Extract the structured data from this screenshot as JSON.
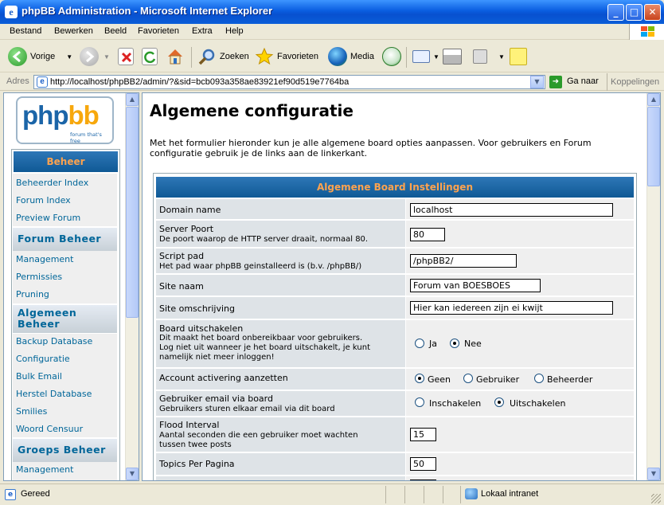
{
  "window": {
    "title": "phpBB Administration - Microsoft Internet Explorer"
  },
  "menu": [
    "Bestand",
    "Bewerken",
    "Beeld",
    "Favorieten",
    "Extra",
    "Help"
  ],
  "toolbar": {
    "back": "Vorige",
    "search": "Zoeken",
    "favorites": "Favorieten",
    "media": "Media"
  },
  "address": {
    "label": "Adres",
    "url": "http://localhost/phpBB2/admin/?&sid=bcb093a358ae83921ef90d519e7764ba",
    "go": "Ga naar",
    "links": "Koppelingen"
  },
  "logo": {
    "text_a": "php",
    "text_b": "bb",
    "tagline": "forum that's free"
  },
  "nav": {
    "beheer": "Beheer",
    "beheer_items": [
      "Beheerder Index",
      "Forum Index",
      "Preview Forum"
    ],
    "forum_beheer": "Forum Beheer",
    "forum_items": [
      "Management",
      "Permissies",
      "Pruning"
    ],
    "algemeen_beheer_1": "Algemeen",
    "algemeen_beheer_2": "Beheer",
    "algemeen_items": [
      "Backup Database",
      "Configuratie",
      "Bulk Email",
      "Herstel Database",
      "Smilies",
      "Woord Censuur"
    ],
    "groeps_beheer": "Groeps Beheer",
    "groeps_items": [
      "Management"
    ]
  },
  "page": {
    "title": "Algemene configuratie",
    "intro_1": "Met het formulier hieronder kun je alle algemene board opties aanpassen. Voor gebruikers en Forum",
    "intro_2": "configuratie gebruik je de links aan de linkerkant.",
    "table_header": "Algemene Board Instellingen"
  },
  "form": {
    "domain_name": {
      "label": "Domain name",
      "value": "localhost"
    },
    "server_port": {
      "label": "Server Poort",
      "desc": "De poort waarop de HTTP server draait, normaal 80.",
      "value": "80"
    },
    "script_path": {
      "label": "Script pad",
      "desc": "Het pad waar phpBB geinstalleerd is (b.v. /phpBB/)",
      "value": "/phpBB2/"
    },
    "site_name": {
      "label": "Site naam",
      "value": "Forum van BOESBOES"
    },
    "site_desc": {
      "label": "Site omschrijving",
      "value": "Hier kan iedereen zijn ei kwijt"
    },
    "disable_board": {
      "label": "Board uitschakelen",
      "desc_1": "Dit maakt het board onbereikbaar voor gebruikers.",
      "desc_2": "Log niet uit wanneer je het board uitschakelt, je kunt",
      "desc_3": "namelijk niet meer inloggen!",
      "opt_yes": "Ja",
      "opt_no": "Nee",
      "selected": "Nee"
    },
    "account_activation": {
      "label": "Account activering aanzetten",
      "opt_none": "Geen",
      "opt_user": "Gebruiker",
      "opt_admin": "Beheerder",
      "selected": "Geen"
    },
    "user_email": {
      "label": "Gebruiker email via board",
      "desc": "Gebruikers sturen elkaar email via dit board",
      "opt_on": "Inschakelen",
      "opt_off": "Uitschakelen",
      "selected": "Uitschakelen"
    },
    "flood_interval": {
      "label": "Flood Interval",
      "desc_1": "Aantal seconden die een gebruiker moet wachten",
      "desc_2": "tussen twee posts",
      "value": "15"
    },
    "topics_per_page": {
      "label": "Topics Per Pagina",
      "value": "50"
    }
  },
  "status": {
    "left": "Gereed",
    "zone": "Lokaal intranet"
  },
  "colors": {
    "nav_link": "#006699",
    "header_bar": "#1B6BA8",
    "row_bg": "#DEE3E7",
    "value_bg": "#EFEFEF",
    "header_text": "#FFA34F"
  }
}
